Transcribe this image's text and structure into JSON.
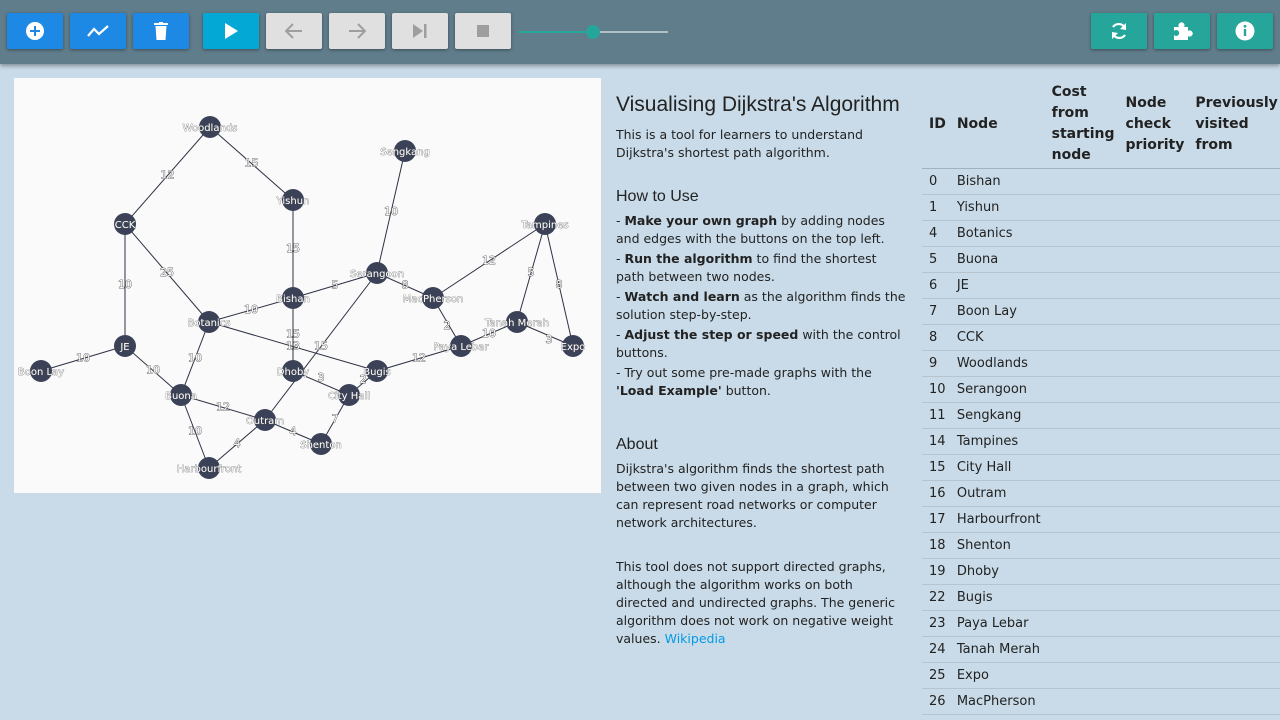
{
  "toolbar": {
    "buttons": [
      {
        "name": "add-node-button",
        "icon": "plus-circle-icon"
      },
      {
        "name": "add-edge-button",
        "icon": "trend-line-icon"
      },
      {
        "name": "delete-button",
        "icon": "trash-icon"
      },
      {
        "name": "run-button",
        "icon": "play-icon"
      },
      {
        "name": "step-back-button",
        "icon": "arrow-left-icon"
      },
      {
        "name": "step-forward-button",
        "icon": "arrow-right-icon"
      },
      {
        "name": "skip-to-end-button",
        "icon": "skip-end-icon"
      },
      {
        "name": "stop-button",
        "icon": "stop-icon"
      },
      {
        "name": "reset-button",
        "icon": "refresh-icon"
      },
      {
        "name": "load-example-button",
        "icon": "puzzle-icon"
      },
      {
        "name": "info-button",
        "icon": "info-icon"
      }
    ],
    "speed_slider_value": 0.5,
    "colors": {
      "toolbar": "#607d8b",
      "blue": "#1e88e5",
      "cyan": "#03a9d4",
      "disabled": "#e0e0e0",
      "teal": "#26a69a"
    }
  },
  "graph": {
    "nodes": [
      {
        "id": "woodlands",
        "label": "Woodlands"
      },
      {
        "id": "sengkang",
        "label": "Sengkang"
      },
      {
        "id": "yishun",
        "label": "Yishun"
      },
      {
        "id": "cck",
        "label": "CCK"
      },
      {
        "id": "tampines",
        "label": "Tampines"
      },
      {
        "id": "serangoon",
        "label": "Serangoon"
      },
      {
        "id": "bishan",
        "label": "Bishan"
      },
      {
        "id": "macpherson",
        "label": "MacPherson"
      },
      {
        "id": "botanics",
        "label": "Botanics"
      },
      {
        "id": "tanahmerah",
        "label": "Tanah Merah"
      },
      {
        "id": "payalebar",
        "label": "Paya Lebar"
      },
      {
        "id": "je",
        "label": "JE"
      },
      {
        "id": "expo",
        "label": "Expo"
      },
      {
        "id": "boonlay",
        "label": "Boon Lay"
      },
      {
        "id": "dhoby",
        "label": "Dhoby"
      },
      {
        "id": "bugis",
        "label": "Bugis"
      },
      {
        "id": "buona",
        "label": "Buona"
      },
      {
        "id": "cityhall",
        "label": "City Hall"
      },
      {
        "id": "outram",
        "label": "Outram"
      },
      {
        "id": "shenton",
        "label": "Shenton"
      },
      {
        "id": "harbourfront",
        "label": "Harbourfront"
      }
    ],
    "edges": [
      {
        "from": "woodlands",
        "to": "cck",
        "weight": "12"
      },
      {
        "from": "woodlands",
        "to": "yishun",
        "weight": "15"
      },
      {
        "from": "yishun",
        "to": "bishan",
        "weight": "15"
      },
      {
        "from": "sengkang",
        "to": "serangoon",
        "weight": "10"
      },
      {
        "from": "cck",
        "to": "je",
        "weight": "10"
      },
      {
        "from": "cck",
        "to": "botanics",
        "weight": "25"
      },
      {
        "from": "je",
        "to": "boonlay",
        "weight": "10"
      },
      {
        "from": "je",
        "to": "buona",
        "weight": "10"
      },
      {
        "from": "botanics",
        "to": "bishan",
        "weight": "10"
      },
      {
        "from": "botanics",
        "to": "buona",
        "weight": "10"
      },
      {
        "from": "botanics",
        "to": "bugis",
        "weight": "13"
      },
      {
        "from": "bishan",
        "to": "serangoon",
        "weight": "5"
      },
      {
        "from": "bishan",
        "to": "dhoby",
        "weight": "15"
      },
      {
        "from": "serangoon",
        "to": "macpherson",
        "weight": "8"
      },
      {
        "from": "serangoon",
        "to": "outram",
        "weight": "15"
      },
      {
        "from": "macpherson",
        "to": "tampines",
        "weight": "12"
      },
      {
        "from": "macpherson",
        "to": "payalebar",
        "weight": "2"
      },
      {
        "from": "tampines",
        "to": "tanahmerah",
        "weight": "5"
      },
      {
        "from": "tampines",
        "to": "expo",
        "weight": "8"
      },
      {
        "from": "tanahmerah",
        "to": "expo",
        "weight": "3"
      },
      {
        "from": "tanahmerah",
        "to": "payalebar",
        "weight": "10"
      },
      {
        "from": "payalebar",
        "to": "bugis",
        "weight": "12"
      },
      {
        "from": "dhoby",
        "to": "cityhall",
        "weight": "3"
      },
      {
        "from": "cityhall",
        "to": "bugis",
        "weight": "2"
      },
      {
        "from": "cityhall",
        "to": "shenton",
        "weight": "7"
      },
      {
        "from": "buona",
        "to": "outram",
        "weight": "12"
      },
      {
        "from": "buona",
        "to": "harbourfront",
        "weight": "10"
      },
      {
        "from": "outram",
        "to": "harbourfront",
        "weight": "4"
      },
      {
        "from": "outram",
        "to": "shenton",
        "weight": "4"
      }
    ]
  },
  "info": {
    "title": "Visualising Dijkstra's Algorithm",
    "intro": "This is a tool for learners to understand Dijkstra's shortest path algorithm.",
    "how_to_title": "How to Use",
    "how_to": [
      {
        "prefix": "- ",
        "bold": "Make your own graph",
        "text": " by adding nodes and edges with the buttons on the top left."
      },
      {
        "prefix": "- ",
        "bold": "Run the algorithm",
        "text": " to find the shortest path between two nodes."
      },
      {
        "prefix": "- ",
        "bold": "Watch and learn",
        "text": " as the algorithm finds the solution step-by-step."
      },
      {
        "prefix": "- ",
        "bold": "Adjust the step or speed",
        "text": " with the control buttons."
      },
      {
        "prefix": "- Try out some pre-made graphs with the ",
        "bold": "'Load Example'",
        "text": " button."
      }
    ],
    "about_title": "About",
    "about_p1": "Dijkstra's algorithm finds the shortest path between two given nodes in a graph, which can represent road networks or computer network architectures.",
    "about_p2": "This tool does not support directed graphs, although the algorithm works on both directed and undirected graphs. The generic algorithm does not work on negative weight values.",
    "about_link": "Wikipedia"
  },
  "table": {
    "headers": [
      "ID",
      "Node",
      "Cost from starting node",
      "Node check priority",
      "Previously visited from"
    ],
    "rows": [
      {
        "id": "0",
        "node": "Bishan"
      },
      {
        "id": "1",
        "node": "Yishun"
      },
      {
        "id": "4",
        "node": "Botanics"
      },
      {
        "id": "5",
        "node": "Buona"
      },
      {
        "id": "6",
        "node": "JE"
      },
      {
        "id": "7",
        "node": "Boon Lay"
      },
      {
        "id": "8",
        "node": "CCK"
      },
      {
        "id": "9",
        "node": "Woodlands"
      },
      {
        "id": "10",
        "node": "Serangoon"
      },
      {
        "id": "11",
        "node": "Sengkang"
      },
      {
        "id": "14",
        "node": "Tampines"
      },
      {
        "id": "15",
        "node": "City Hall"
      },
      {
        "id": "16",
        "node": "Outram"
      },
      {
        "id": "17",
        "node": "Harbourfront"
      },
      {
        "id": "18",
        "node": "Shenton"
      },
      {
        "id": "19",
        "node": "Dhoby"
      },
      {
        "id": "22",
        "node": "Bugis"
      },
      {
        "id": "23",
        "node": "Paya Lebar"
      },
      {
        "id": "24",
        "node": "Tanah Merah"
      },
      {
        "id": "25",
        "node": "Expo"
      },
      {
        "id": "26",
        "node": "MacPherson"
      }
    ]
  }
}
